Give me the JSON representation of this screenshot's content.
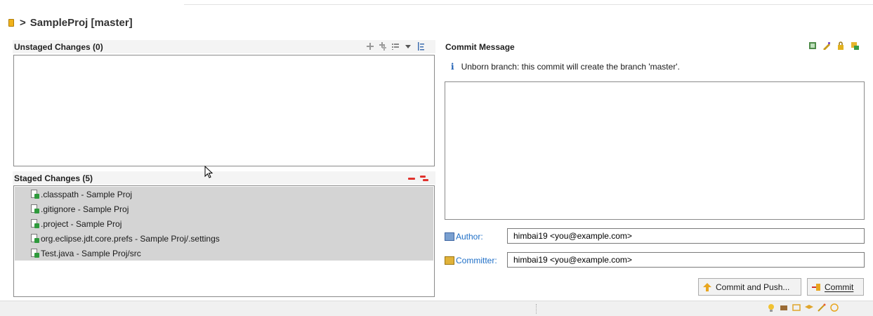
{
  "header": {
    "separator": ">",
    "title": "SampleProj [master]"
  },
  "unstaged": {
    "title": "Unstaged Changes (0)"
  },
  "staged": {
    "title": "Staged Changes (5)",
    "items": [
      ".classpath - Sample Proj",
      ".gitignore - Sample Proj",
      ".project - Sample Proj",
      "org.eclipse.jdt.core.prefs - Sample Proj/.settings",
      "Test.java - Sample Proj/src"
    ]
  },
  "commit": {
    "title": "Commit Message",
    "info_icon": "i",
    "info": "Unborn branch: this commit will create the branch 'master'.",
    "message": "",
    "author_label": "Author:",
    "author_value": "himbai19 <you@example.com>",
    "committer_label": "Committer:",
    "committer_value": "himbai19 <you@example.com>",
    "commit_push_label": "Commit and Push...",
    "commit_label": "Commit"
  },
  "colors": {
    "accent": "#1f6fc7",
    "remove": "#e0322d",
    "add": "#2e9a3c"
  }
}
